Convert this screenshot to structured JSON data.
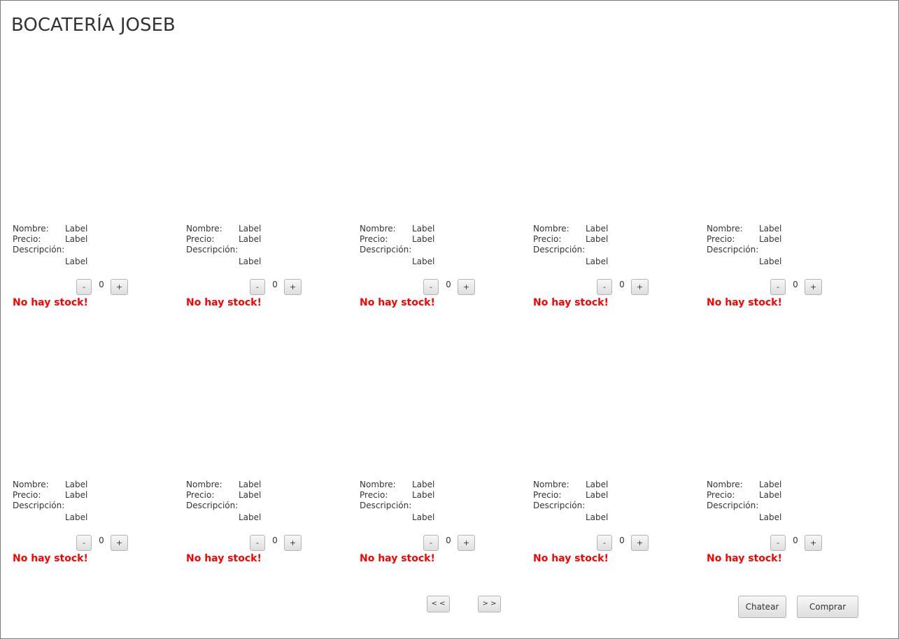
{
  "app": {
    "title": "BOCATERÍA JOSEB"
  },
  "labels": {
    "nombre": "Nombre:",
    "precio": "Precio:",
    "descripcion": "Descripción:",
    "minus": "-",
    "plus": "+"
  },
  "products": [
    {
      "nombre": "Label",
      "precio": "Label",
      "descripcion": "Label",
      "cantidad": "0",
      "stock_msg": "No hay stock!"
    },
    {
      "nombre": "Label",
      "precio": "Label",
      "descripcion": "Label",
      "cantidad": "0",
      "stock_msg": "No hay stock!"
    },
    {
      "nombre": "Label",
      "precio": "Label",
      "descripcion": "Label",
      "cantidad": "0",
      "stock_msg": "No hay stock!"
    },
    {
      "nombre": "Label",
      "precio": "Label",
      "descripcion": "Label",
      "cantidad": "0",
      "stock_msg": "No hay stock!"
    },
    {
      "nombre": "Label",
      "precio": "Label",
      "descripcion": "Label",
      "cantidad": "0",
      "stock_msg": "No hay stock!"
    },
    {
      "nombre": "Label",
      "precio": "Label",
      "descripcion": "Label",
      "cantidad": "0",
      "stock_msg": "No hay stock!"
    },
    {
      "nombre": "Label",
      "precio": "Label",
      "descripcion": "Label",
      "cantidad": "0",
      "stock_msg": "No hay stock!"
    },
    {
      "nombre": "Label",
      "precio": "Label",
      "descripcion": "Label",
      "cantidad": "0",
      "stock_msg": "No hay stock!"
    },
    {
      "nombre": "Label",
      "precio": "Label",
      "descripcion": "Label",
      "cantidad": "0",
      "stock_msg": "No hay stock!"
    },
    {
      "nombre": "Label",
      "precio": "Label",
      "descripcion": "Label",
      "cantidad": "0",
      "stock_msg": "No hay stock!"
    }
  ],
  "pagination": {
    "prev_label": "< <",
    "next_label": "> >"
  },
  "actions": {
    "chat_label": "Chatear",
    "buy_label": "Comprar"
  },
  "colors": {
    "stock_warning": "#ff0000",
    "text": "#333333",
    "window_border": "#7a7a7a"
  }
}
